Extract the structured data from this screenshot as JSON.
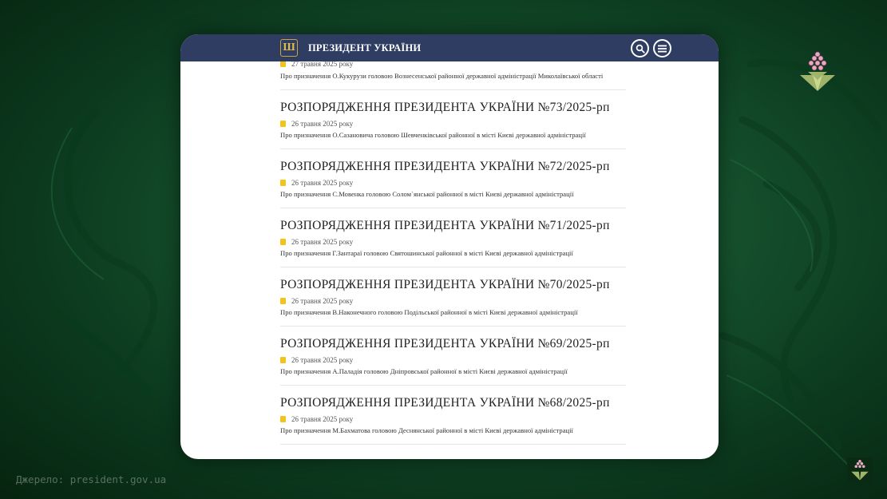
{
  "header": {
    "coat_symbol": "Ш",
    "title": "ПРЕЗИДЕНТ УКРАЇНИ",
    "search_icon": "search-icon",
    "menu_icon": "menu-icon"
  },
  "partial_item": {
    "date": "27 травня 2025 року",
    "description": "Про призначення О.Кукурузи головою Вознесенської районної державної адміністрації Миколаївської області"
  },
  "items": [
    {
      "title": "РОЗПОРЯДЖЕННЯ ПРЕЗИДЕНТА УКРАЇНИ №73/2025-рп",
      "date": "26 травня 2025 року",
      "description": "Про призначення О.Сазановича головою Шевченківської районної в місті Києві державної адміністрації"
    },
    {
      "title": "РОЗПОРЯДЖЕННЯ ПРЕЗИДЕНТА УКРАЇНИ №72/2025-рп",
      "date": "26 травня 2025 року",
      "description": "Про призначення С.Мовенка головою Солом`янської районної в місті Києві державної адміністрації"
    },
    {
      "title": "РОЗПОРЯДЖЕННЯ ПРЕЗИДЕНТА УКРАЇНИ №71/2025-рп",
      "date": "26 травня 2025 року",
      "description": "Про призначення Г.Зантараї головою Святошинської районної в місті Києві державної адміністрації"
    },
    {
      "title": "РОЗПОРЯДЖЕННЯ ПРЕЗИДЕНТА УКРАЇНИ №70/2025-рп",
      "date": "26 травня 2025 року",
      "description": "Про призначення В.Наконечного головою Подільської районної в місті Києві державної адміністрації"
    },
    {
      "title": "РОЗПОРЯДЖЕННЯ ПРЕЗИДЕНТА УКРАЇНИ №69/2025-рп",
      "date": "26 травня 2025 року",
      "description": "Про призначення А.Паладія головою Дніпровської районної в місті Києві державної адміністрації"
    },
    {
      "title": "РОЗПОРЯДЖЕННЯ ПРЕЗИДЕНТА УКРАЇНИ №68/2025-рп",
      "date": "26 травня 2025 року",
      "description": "Про призначення М.Бахматова головою Деснянської районної в місті Києві державної адміністрації"
    }
  ],
  "overlay": {
    "source": "Джерело: president.gov.ua",
    "logo_icon": "flower-logo-icon"
  },
  "colors": {
    "header_bg": "#2f3d63",
    "accent_yellow": "#f2c419",
    "background_green": "#15502c"
  }
}
